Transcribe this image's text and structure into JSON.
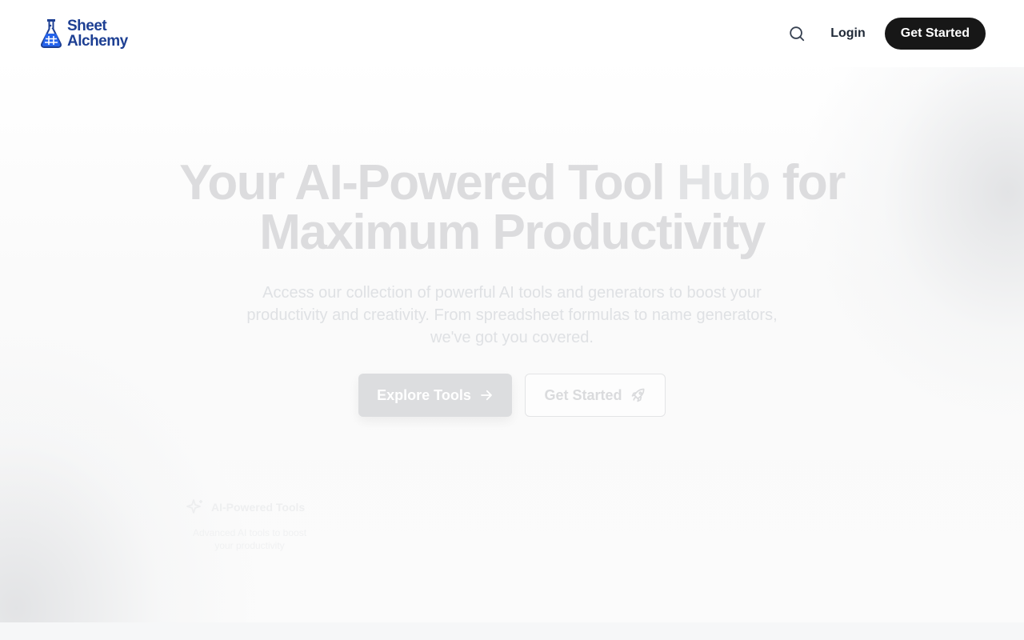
{
  "header": {
    "logo_line1": "Sheet",
    "logo_line2": "Alchemy",
    "login_label": "Login",
    "cta_label": "Get Started"
  },
  "icons": {
    "logo": "flask-icon",
    "search": "search-icon",
    "explore": "arrow-right-icon",
    "get_started": "rocket-icon",
    "feature": "sparkles-icon"
  },
  "hero": {
    "title_part1": "Your AI-Powered Tool ",
    "title_hub": "Hub",
    "title_part2": " for",
    "title_line2": "Maximum Productivity",
    "subtitle": "Access our collection of powerful AI tools and generators to boost your productivity and creativity. From spreadsheet formulas to name generators, we've got you covered.",
    "primary_button": "Explore Tools",
    "secondary_button": "Get Started"
  },
  "feature": {
    "title": "AI-Powered Tools",
    "description": "Advanced AI tools to boost your productivity"
  },
  "colors": {
    "brand": "#1d3f93",
    "brand_light": "#2563eb",
    "cta_dark": "#171717"
  }
}
